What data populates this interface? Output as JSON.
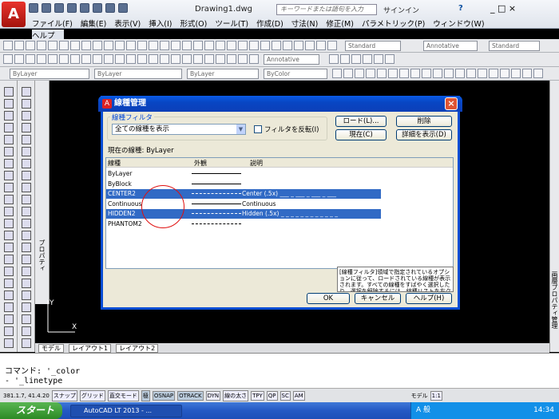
{
  "app": {
    "doc_title": "Drawing1.dwg",
    "search_placeholder": "キーワードまたは語句を入力",
    "sign_in": "サインイン",
    "window_controls": "_ □ ×"
  },
  "menu": [
    "ファイル(F)",
    "編集(E)",
    "表示(V)",
    "挿入(I)",
    "形式(O)",
    "ツール(T)",
    "作成(D)",
    "寸法(N)",
    "修正(M)",
    "パラメトリック(P)",
    "ウィンドウ(W)"
  ],
  "menu_help": "ヘルプ(H)",
  "toolbar": {
    "text_style": "Standard",
    "annotative": "Annotative",
    "dim_style": "Standard",
    "layer_color": "ByLayer",
    "linetype": "ByLayer",
    "lineweight": "ByLayer",
    "plotstyle": "ByColor",
    "annotative2": "Annotative"
  },
  "palette": {
    "properties": "プロパティ",
    "right_palette": "画層プロパティ管理"
  },
  "tabs": [
    "モデル",
    "レイアウト1",
    "レイアウト2"
  ],
  "command": {
    "line1": "コマンド: '_color",
    "line2": "- '_linetype"
  },
  "status": {
    "coords": "381.1.7, 41.4.20",
    "buttons": [
      "スナップ",
      "グリッド",
      "直交モード",
      "極",
      "OSNAP",
      "OTRACK",
      "DYN",
      "線の太さ",
      "TPY",
      "QP",
      "SC",
      "AM"
    ],
    "model_label": "モデル",
    "scale": "1:1"
  },
  "taskbar": {
    "start": "スタート",
    "task": "AutoCAD LT 2013 - ...",
    "tray_text": "A 般",
    "clock": "14:34"
  },
  "dialog": {
    "title": "線種管理",
    "filter_group": "線種フィルタ",
    "filter_value": "全ての線種を表示",
    "invert_label": "フィルタを反転(I)",
    "load_btn": "ロード(L)...",
    "delete_btn": "削除",
    "current_btn": "現在(C)",
    "details_btn": "詳細を表示(D)",
    "current_linetype": "現在の線種: ByLayer",
    "headers": {
      "name": "線種",
      "appearance": "外観",
      "desc": "説明"
    },
    "rows": [
      {
        "name": "ByLayer",
        "desc": "",
        "selected": false
      },
      {
        "name": "ByBlock",
        "desc": "",
        "selected": false
      },
      {
        "name": "CENTER2",
        "desc": "Center (.5x) ___ _ ___ _ ___ _ ___",
        "selected": true
      },
      {
        "name": "Continuous",
        "desc": "Continuous",
        "selected": false
      },
      {
        "name": "HIDDEN2",
        "desc": "Hidden (.5x) _ _ _ _ _ _ _ _ _ _ _ _",
        "selected": true
      },
      {
        "name": "PHANTOM2",
        "desc": "",
        "selected": false
      }
    ],
    "details_text": "[線種フィルタ]領域で指定されているオプションに従って、ロードされている線種が表示されます。すべての線種をすばやく選択したり、選択を解除するには、線種リストを右クリックし、ショートカット メニューを表示します。",
    "ok": "OK",
    "cancel": "キャンセル",
    "help": "ヘルプ(H)"
  },
  "colors": {
    "selection": "#316ac5",
    "dialog_title": "#0846c4",
    "annotation_circle": "#e01010"
  }
}
